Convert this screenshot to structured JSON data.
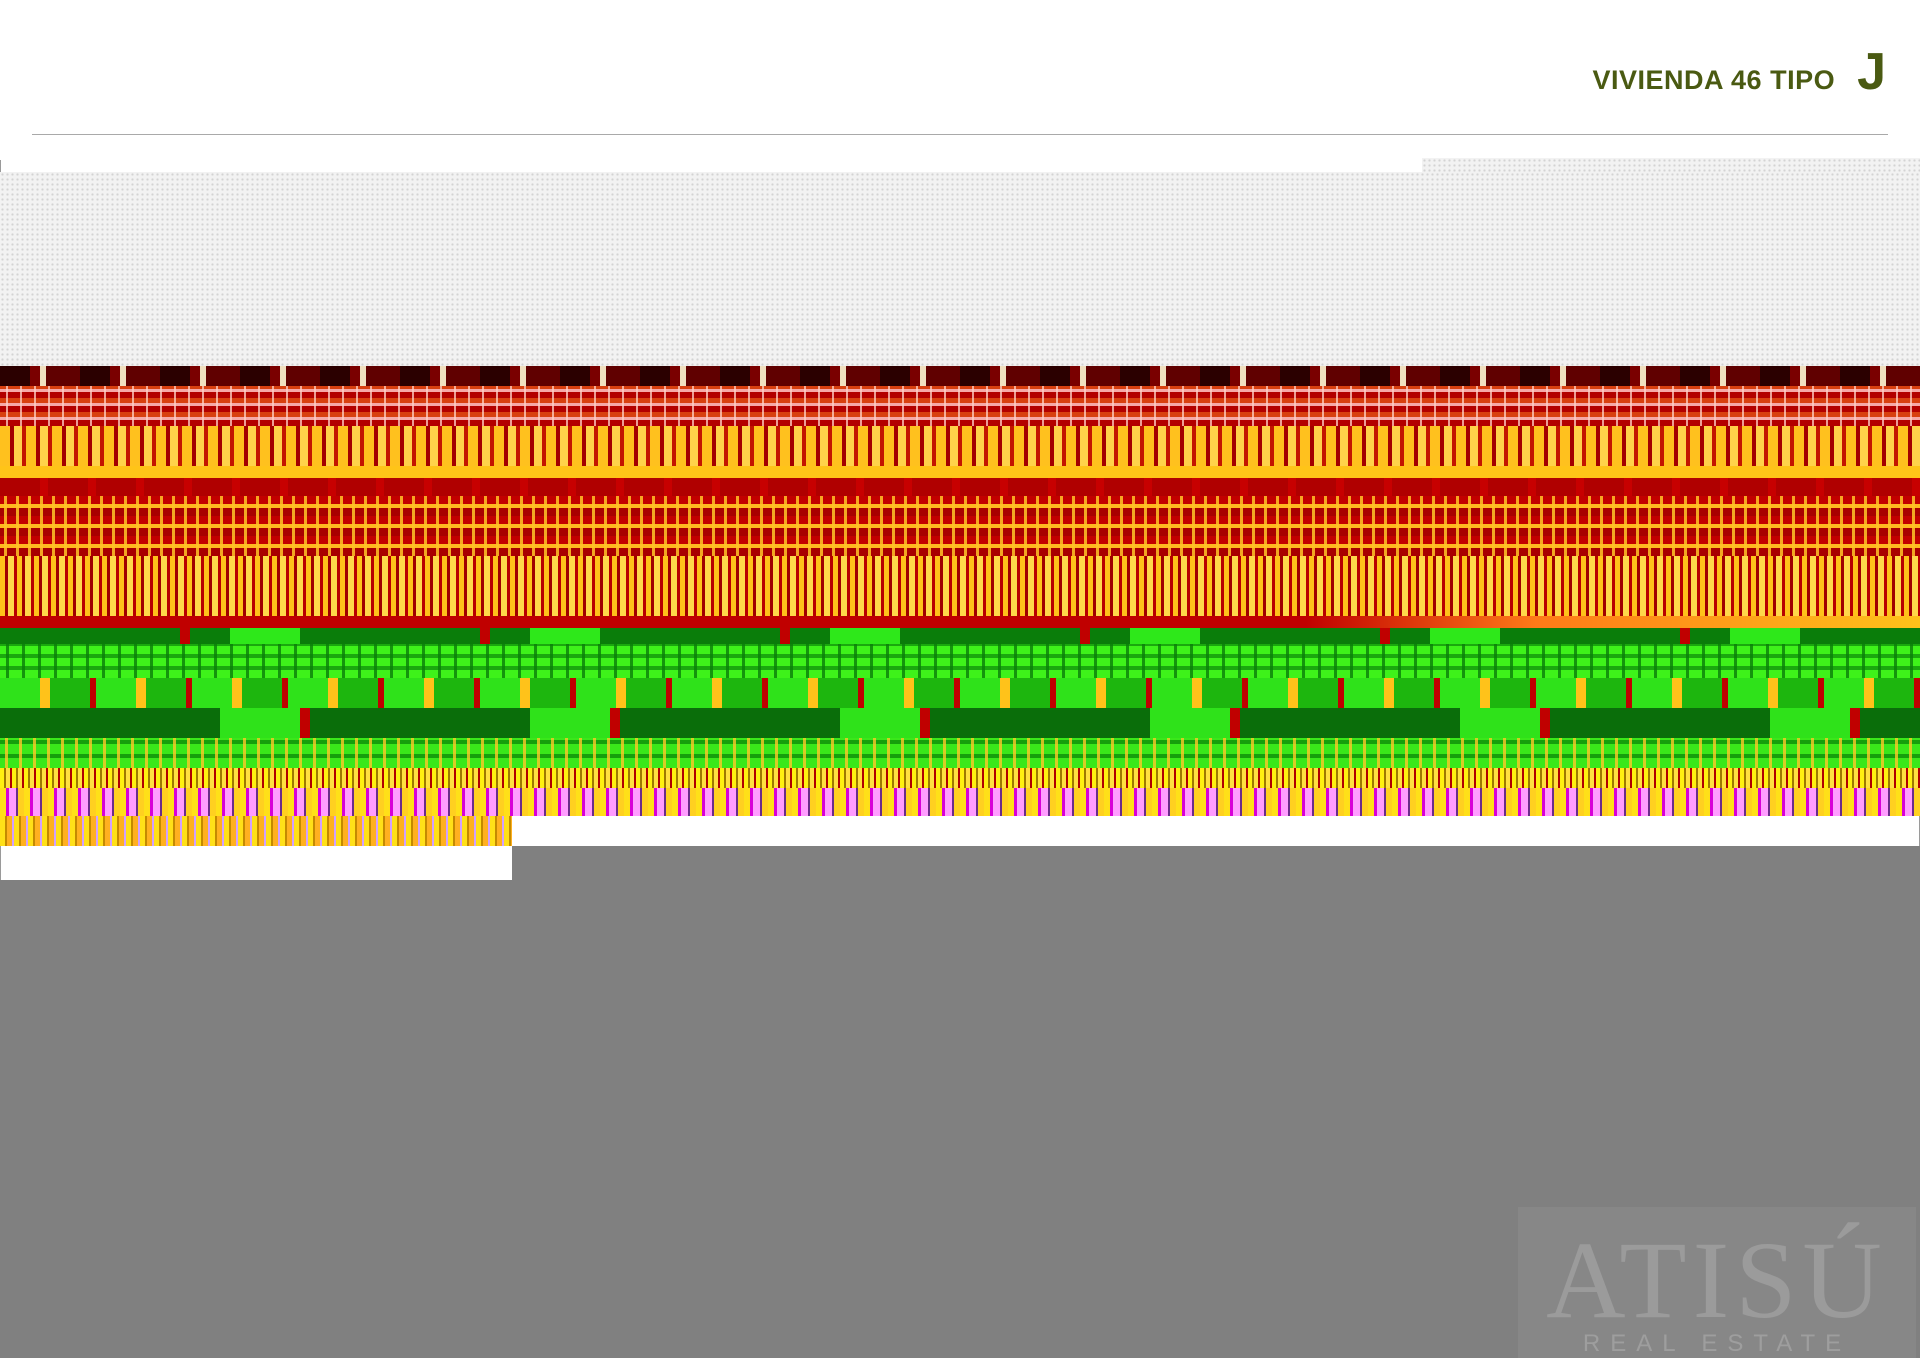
{
  "header": {
    "title_label": "VIVIENDA 46 TIPO",
    "title_letter": "J"
  },
  "watermark": {
    "brand": "ATISÚ",
    "tagline": "REAL ESTATE"
  },
  "colors": {
    "title": "#4a5a12",
    "rule": "#a9a9a9",
    "base_gray": "#808080"
  }
}
